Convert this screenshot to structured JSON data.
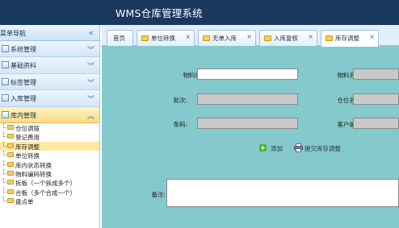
{
  "header": {
    "title": "WMS仓库管理系统"
  },
  "sidebar": {
    "title": "菜单导航",
    "groups": [
      {
        "label": "系统管理"
      },
      {
        "label": "基础资料"
      },
      {
        "label": "标签管理"
      },
      {
        "label": "入库管理"
      },
      {
        "label": "库内管理"
      }
    ],
    "subitems": [
      {
        "label": "仓位调拨"
      },
      {
        "label": "登记费用"
      },
      {
        "label": "库存调整"
      },
      {
        "label": "单位转换"
      },
      {
        "label": "库内状态转换"
      },
      {
        "label": "物料编码转换"
      },
      {
        "label": "拆板（一个拆成多个）"
      },
      {
        "label": "合板（多个合成一个）"
      },
      {
        "label": "盘点单"
      }
    ]
  },
  "tabs": [
    {
      "label": "首页"
    },
    {
      "label": "单位转换"
    },
    {
      "label": "无单入库"
    },
    {
      "label": "入库复核"
    },
    {
      "label": "库存调整"
    }
  ],
  "form": {
    "material_code_label": "物料编码:",
    "material_code_value": "",
    "material_name_label": "物料名称:",
    "material_name_value": "",
    "batch_label": "批次:",
    "batch_value": "",
    "location_name_label": "仓位名称:",
    "location_name_value": "",
    "barcode_label": "条码:",
    "barcode_value": "",
    "customer_code_label": "客户编码:",
    "customer_code_value": "",
    "remark_label": "备注:",
    "remark_value": ""
  },
  "actions": {
    "add_label": "添加",
    "submit_label": "提交库存调整"
  },
  "colors": {
    "header_bg": "#18385d",
    "content_bg": "#84c9cb",
    "active_item_bg": "#fde9a3"
  }
}
